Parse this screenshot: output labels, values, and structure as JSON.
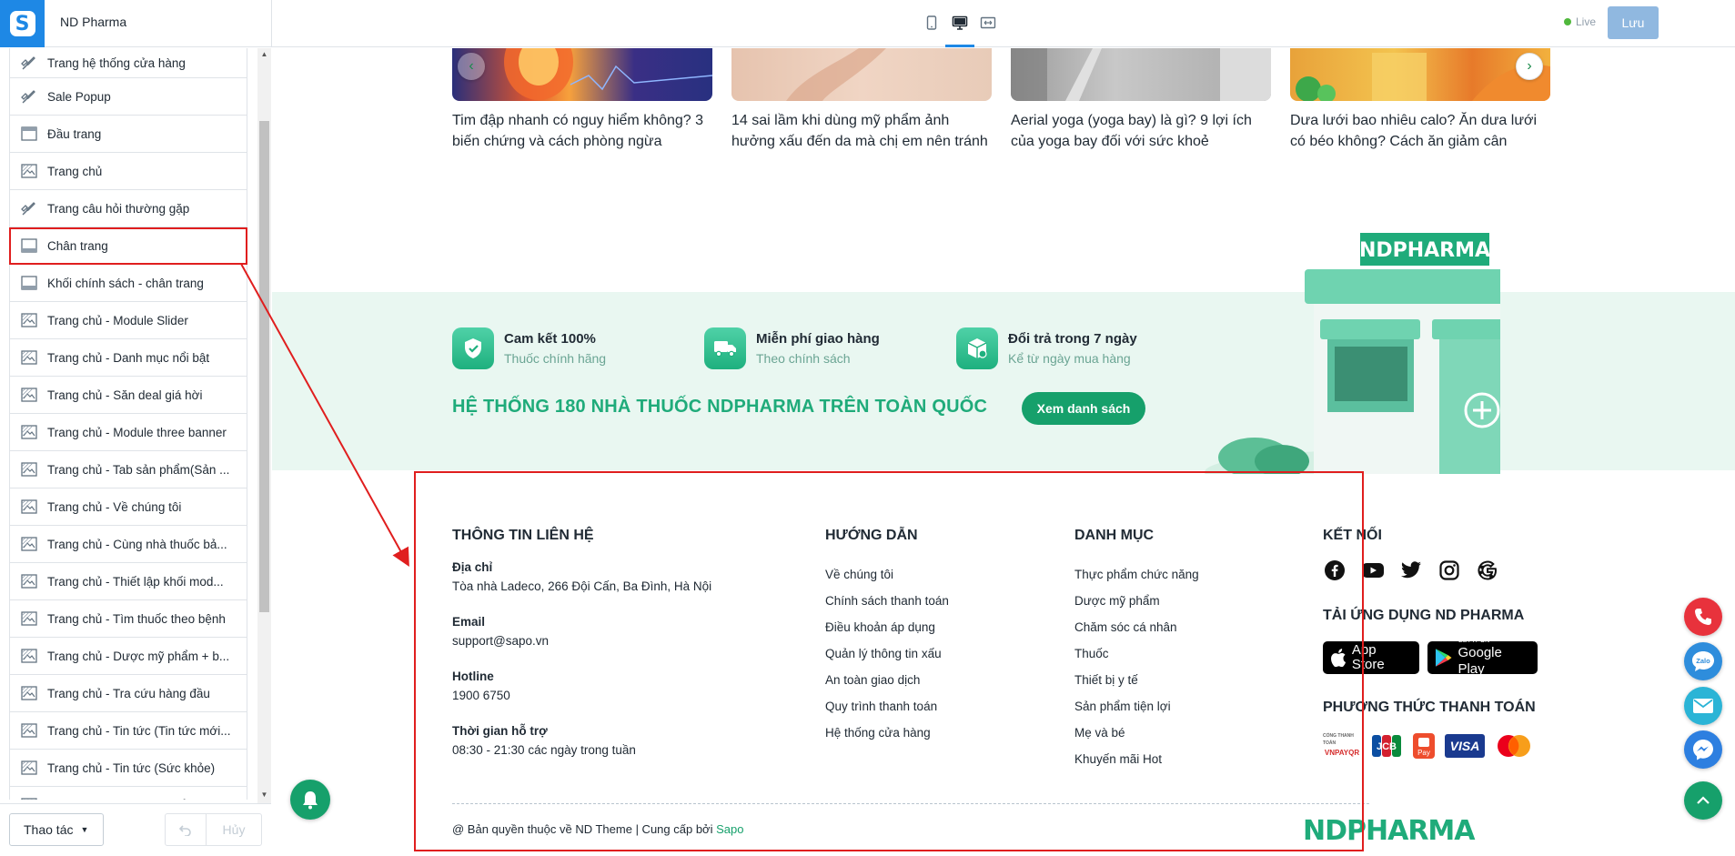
{
  "topbar": {
    "store_name": "ND Pharma",
    "live_label": "Live",
    "save_label": "Lưu"
  },
  "sidebar": {
    "items": [
      {
        "label": "Trang hệ thống cửa hàng",
        "icon": "brush-icon"
      },
      {
        "label": "Sale Popup",
        "icon": "brush-icon"
      },
      {
        "label": "Đầu trang",
        "icon": "header-layout-icon"
      },
      {
        "label": "Trang chủ",
        "icon": "template-icon"
      },
      {
        "label": "Trang câu hỏi thường gặp",
        "icon": "brush-icon"
      },
      {
        "label": "Chân trang",
        "icon": "footer-layout-icon"
      },
      {
        "label": "Khối chính sách - chân trang",
        "icon": "footer-layout-icon"
      },
      {
        "label": "Trang chủ - Module Slider",
        "icon": "template-icon"
      },
      {
        "label": "Trang chủ - Danh mục nổi bật",
        "icon": "template-icon"
      },
      {
        "label": "Trang chủ - Săn deal giá hời",
        "icon": "template-icon"
      },
      {
        "label": "Trang chủ - Module three banner",
        "icon": "template-icon"
      },
      {
        "label": "Trang chủ - Tab sản phẩm(Sản ...",
        "icon": "template-icon"
      },
      {
        "label": "Trang chủ - Về chúng tôi",
        "icon": "template-icon"
      },
      {
        "label": "Trang chủ - Cùng nhà thuốc bả...",
        "icon": "template-icon"
      },
      {
        "label": "Trang chủ - Thiết lập khối mod...",
        "icon": "template-icon"
      },
      {
        "label": "Trang chủ - Tìm thuốc theo bệnh",
        "icon": "template-icon"
      },
      {
        "label": "Trang chủ - Dược mỹ phẩm + b...",
        "icon": "template-icon"
      },
      {
        "label": "Trang chủ - Tra cứu hàng đầu",
        "icon": "template-icon"
      },
      {
        "label": "Trang chủ - Tin tức (Tin tức mới...",
        "icon": "template-icon"
      },
      {
        "label": "Trang chủ - Tin tức (Sức khỏe)",
        "icon": "template-icon"
      },
      {
        "label": "Trang danh sách sản phẩm",
        "icon": "template-icon"
      }
    ],
    "selected_index": 5,
    "action_label": "Thao tác",
    "cancel_label": "Hủy"
  },
  "news": [
    {
      "title": "Tim đập nhanh có nguy hiểm không? 3 biến chứng và cách phòng ngừa"
    },
    {
      "title": "14 sai lầm khi dùng mỹ phẩm ảnh hưởng xấu đến da mà chị em nên tránh"
    },
    {
      "title": "Aerial yoga (yoga bay) là gì? 9 lợi ích của yoga bay đối với sức khoẻ"
    },
    {
      "title": "Dưa lưới bao nhiêu calo? Ăn dưa lưới có béo không? Cách ăn giảm cân"
    }
  ],
  "policies": [
    {
      "title": "Cam kết 100%",
      "sub": "Thuốc chính hãng",
      "icon": "shield-check-icon"
    },
    {
      "title": "Miễn phí giao hàng",
      "sub": "Theo chính sách",
      "icon": "truck-icon"
    },
    {
      "title": "Đổi trả trong 7 ngày",
      "sub": "Kể từ ngày mua hàng",
      "icon": "box-return-icon"
    }
  ],
  "stores": {
    "heading": "HỆ THỐNG 180 NHÀ THUỐC NDPHARMA TRÊN TOÀN QUỐC",
    "button": "Xem danh sách",
    "sign": "NDPHARMA"
  },
  "footer": {
    "contact": {
      "heading": "THÔNG TIN LIÊN HỆ",
      "address_label": "Địa chỉ",
      "address": "Tòa nhà Ladeco, 266 Đội Cấn, Ba Đình, Hà Nội",
      "email_label": "Email",
      "email": "support@sapo.vn",
      "hotline_label": "Hotline",
      "hotline": "1900 6750",
      "hours_label": "Thời gian hỗ trợ",
      "hours": "08:30 - 21:30 các ngày trong tuần"
    },
    "guide": {
      "heading": "HƯỚNG DẪN",
      "links": [
        "Về chúng tôi",
        "Chính sách thanh toán",
        "Điều khoản áp dụng",
        "Quản lý thông tin xấu",
        "An toàn giao dịch",
        "Quy trình thanh toán",
        "Hệ thống cửa hàng"
      ]
    },
    "category": {
      "heading": "DANH MỤC",
      "links": [
        "Thực phẩm chức năng",
        "Dược mỹ phẩm",
        "Chăm sóc cá nhân",
        "Thuốc",
        "Thiết bị y tế",
        "Sản phẩm tiện lợi",
        "Mẹ và bé",
        "Khuyến mãi Hot"
      ]
    },
    "connect": {
      "heading": "KẾT NỐI",
      "socials": [
        "facebook-icon",
        "youtube-icon",
        "twitter-icon",
        "instagram-icon",
        "google-icon"
      ],
      "app_heading": "TẢI ỨNG DỤNG ND PHARMA",
      "app_store": "App Store",
      "google_play_small": "GET IT ON",
      "google_play": "Google Play",
      "payment_heading": "PHƯƠNG THỨC THANH TOÁN",
      "payments": [
        "VNPAYQR",
        "JCB",
        "Pay",
        "VISA",
        "mastercard-icon"
      ]
    },
    "copyright_text": "@ Bản quyền thuộc về ND Theme | Cung cấp bởi ",
    "copyright_link": "Sapo",
    "logo": "NDPHARMA"
  },
  "colors": {
    "brand_green": "#16a06b",
    "highlight_red": "#e01e1e",
    "sapo_blue": "#1e88e5"
  }
}
